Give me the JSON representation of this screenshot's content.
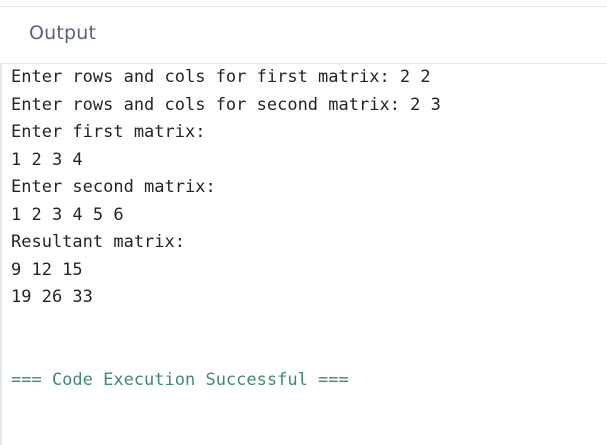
{
  "header": {
    "title": "Output"
  },
  "console": {
    "lines": [
      "Enter rows and cols for first matrix: 2 2",
      "Enter rows and cols for second matrix: 2 3",
      "Enter first matrix:",
      "1 2 3 4",
      "Enter second matrix:",
      "1 2 3 4 5 6",
      "Resultant matrix:",
      "9 12 15",
      "19 26 33",
      "",
      "",
      "=== Code Execution Successful ==="
    ]
  },
  "colors": {
    "text": "#1f2328",
    "success": "#3d8b73",
    "header_text": "#5a6478",
    "border": "#e6e8eb"
  }
}
